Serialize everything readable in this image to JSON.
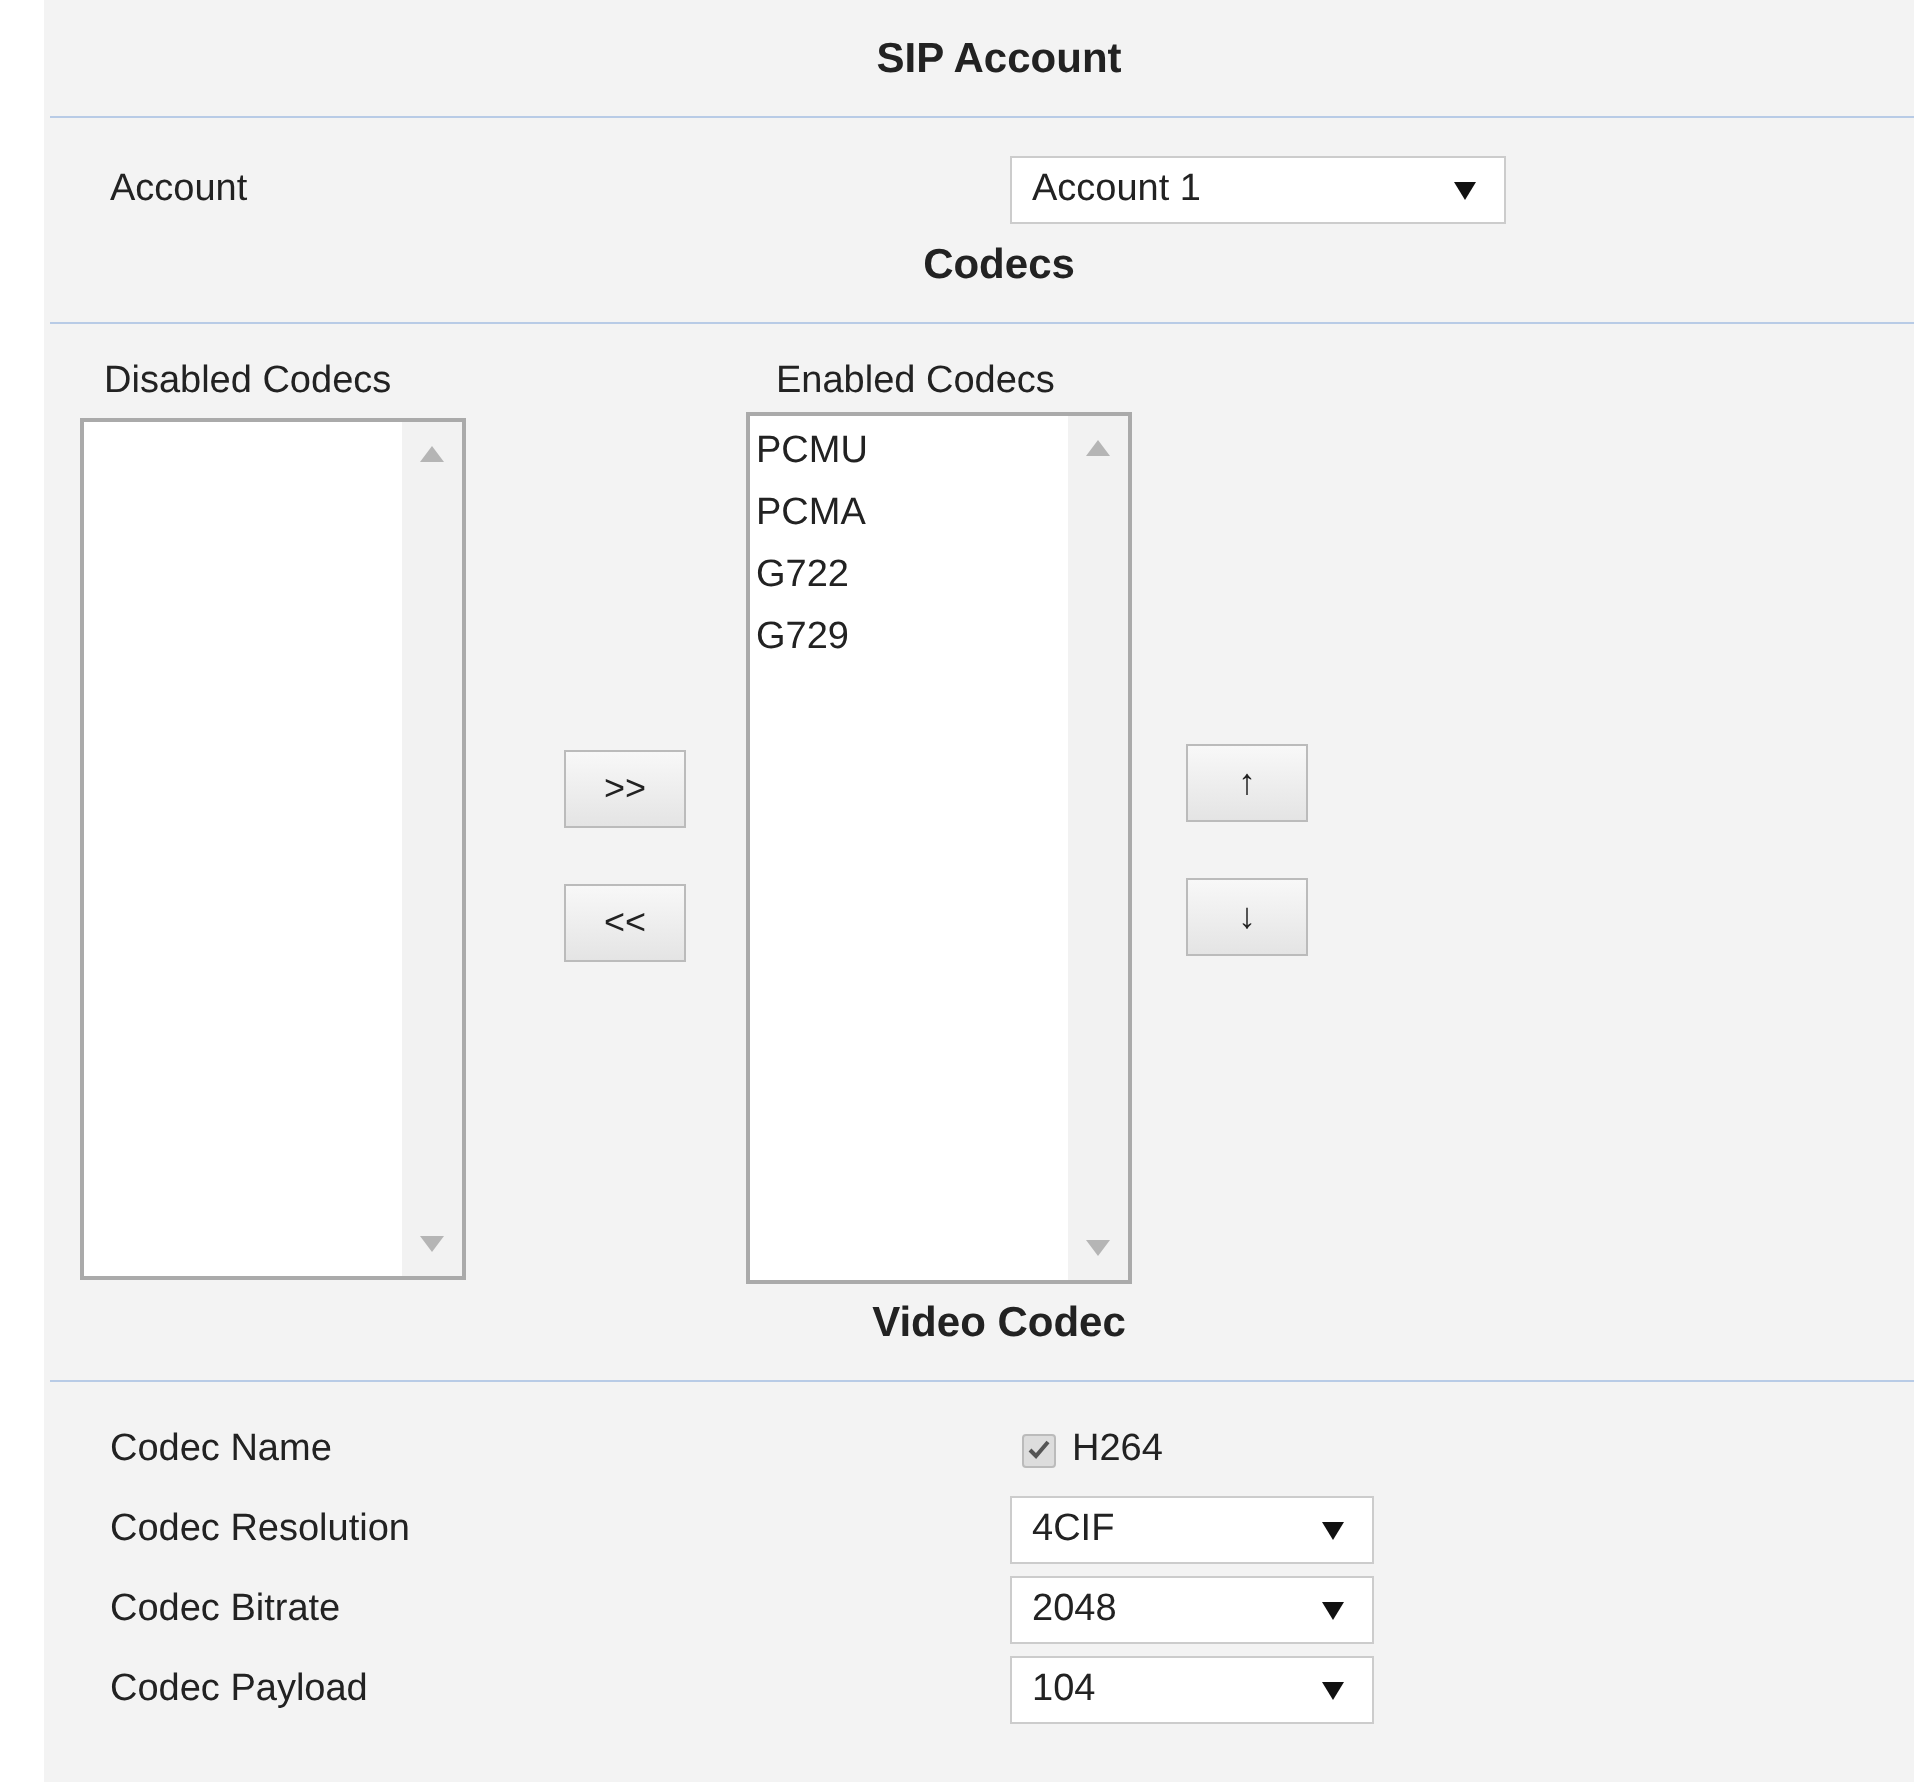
{
  "sections": [
    {
      "title": "SIP Account",
      "rows": [
        {
          "kind": "select",
          "label": "Account",
          "value": "Account 1"
        }
      ]
    },
    {
      "title": "Codecs",
      "codecs": {
        "disabled": {
          "label": "Disabled Codecs"
        },
        "enabled": {
          "label": "Enabled Codecs",
          "items": [
            "PCMU",
            "PCMA",
            "G722",
            "G729"
          ]
        },
        "move_buttons": [
          ">>",
          "<<"
        ],
        "order_buttons": [
          "↑",
          "↓"
        ]
      }
    },
    {
      "title": "Video Codec",
      "rows": [
        {
          "kind": "checkbox",
          "label": "Codec Name",
          "value": "H264",
          "checked": true
        },
        {
          "kind": "select",
          "label": "Codec Resolution",
          "value": "4CIF"
        },
        {
          "kind": "select",
          "label": "Codec Bitrate",
          "value": "2048"
        },
        {
          "kind": "select",
          "label": "Codec Payload",
          "value": "104"
        }
      ]
    }
  ]
}
